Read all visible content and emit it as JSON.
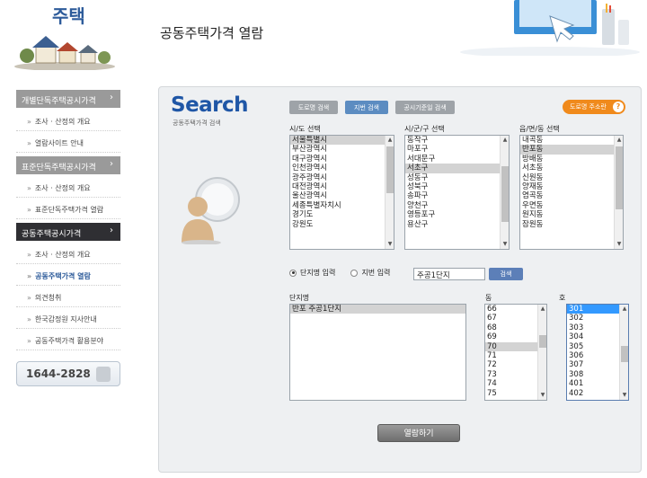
{
  "header": {
    "logo_text": "주택",
    "page_title": "공동주택가격 열람"
  },
  "sidebar": {
    "sections": [
      {
        "label": "개별단독주택공시가격",
        "items": [
          "조사 · 산정의 개요",
          "열람사이트 안내"
        ]
      },
      {
        "label": "표준단독주택공시가격",
        "items": [
          "조사 · 산정의 개요",
          "표준단독주택가격 열람"
        ]
      },
      {
        "label": "공동주택공시가격",
        "items": [
          "조사 · 산정의 개요",
          "공동주택가격 열람",
          "의견청취",
          "한국감정원 지사안내",
          "공동주택가격 활용분야"
        ]
      }
    ],
    "phone": "1644-2828"
  },
  "search": {
    "title": "Search",
    "subtitle": "공동주택가격 검색",
    "tabs": [
      "도로명 검색",
      "지번 검색",
      "공시기준일 검색"
    ],
    "road_address_button": "도로명 주소란",
    "help_icon_text": "?"
  },
  "sido": {
    "label": "시/도 선택",
    "options": [
      "서울특별시",
      "부산광역시",
      "대구광역시",
      "인천광역시",
      "광주광역시",
      "대전광역시",
      "울산광역시",
      "세종특별자치시",
      "경기도",
      "강원도"
    ],
    "selected": "서울특별시"
  },
  "sigungu": {
    "label": "시/군/구 선택",
    "options": [
      "동작구",
      "마포구",
      "서대문구",
      "서초구",
      "성동구",
      "성북구",
      "송파구",
      "양천구",
      "영등포구",
      "용산구"
    ],
    "selected": "서초구"
  },
  "eupmyeondong": {
    "label": "읍/면/동 선택",
    "options": [
      "내곡동",
      "반포동",
      "방배동",
      "서초동",
      "신원동",
      "양재동",
      "염곡동",
      "우면동",
      "원지동",
      "잠원동"
    ],
    "selected": "반포동"
  },
  "input_mode": {
    "option1": "단지명 입력",
    "option2": "지번 입력",
    "selected": "단지명 입력",
    "value": "주공1단지",
    "search_button": "검색"
  },
  "complex": {
    "label": "단지명",
    "options": [
      "반포 주공1단지"
    ],
    "selected": "반포 주공1단지"
  },
  "dong": {
    "label": "동",
    "options": [
      "66",
      "67",
      "68",
      "69",
      "70",
      "71",
      "72",
      "73",
      "74",
      "75"
    ],
    "selected": "70"
  },
  "ho": {
    "label": "호",
    "options": [
      "301",
      "302",
      "303",
      "304",
      "305",
      "306",
      "307",
      "308",
      "401",
      "402"
    ],
    "selected": "301"
  },
  "view_button": "열람하기"
}
